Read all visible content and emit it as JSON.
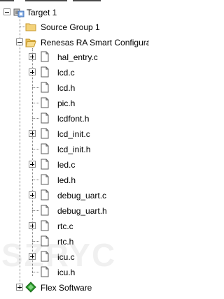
{
  "tree": {
    "root": {
      "label": "Target 1"
    },
    "source_group": {
      "label": "Source Group 1"
    },
    "renesas_group": {
      "label": "Renesas RA Smart Configurator"
    },
    "files": [
      {
        "label": "hal_entry.c",
        "expandable": true
      },
      {
        "label": "lcd.c",
        "expandable": true
      },
      {
        "label": "lcd.h",
        "expandable": false
      },
      {
        "label": "pic.h",
        "expandable": false
      },
      {
        "label": "lcdfont.h",
        "expandable": false
      },
      {
        "label": "lcd_init.c",
        "expandable": true
      },
      {
        "label": "lcd_init.h",
        "expandable": false
      },
      {
        "label": "led.c",
        "expandable": true
      },
      {
        "label": "led.h",
        "expandable": false
      },
      {
        "label": "debug_uart.c",
        "expandable": true
      },
      {
        "label": "debug_uart.h",
        "expandable": false
      },
      {
        "label": "rtc.c",
        "expandable": true
      },
      {
        "label": "rtc.h",
        "expandable": false
      },
      {
        "label": "icu.c",
        "expandable": true
      },
      {
        "label": "icu.h",
        "expandable": false
      }
    ],
    "flex": {
      "label": "Flex Software"
    }
  },
  "watermark": "SZRYC",
  "colors": {
    "folder": "#f3d27a",
    "folder_dark": "#c99a2e",
    "file_page": "#ffffff",
    "file_border": "#5c5c5c",
    "flex_diamond": "#2a9a2a"
  }
}
